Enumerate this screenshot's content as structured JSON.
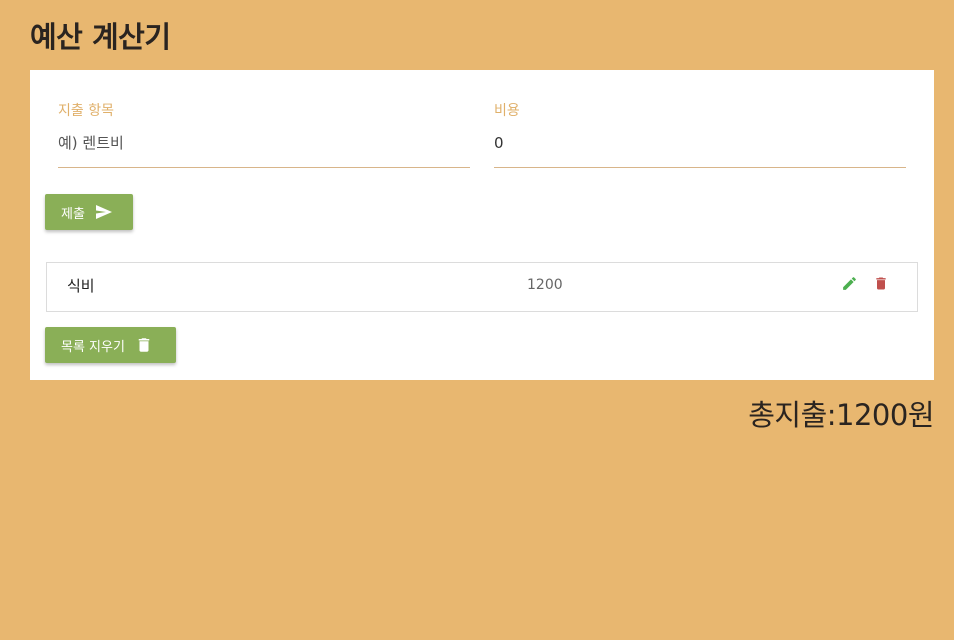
{
  "app": {
    "title": "예산 계산기"
  },
  "form": {
    "name_label": "지출 항목",
    "name_placeholder": "예) 렌트비",
    "name_value": "",
    "cost_label": "비용",
    "cost_value": "0",
    "submit_label": "제출"
  },
  "expenses": [
    {
      "name": "식비",
      "amount": "1200"
    }
  ],
  "clear_button": {
    "label": "목록 지우기"
  },
  "total": {
    "text": "총지출:1200원"
  },
  "icons": {
    "submit": "send-icon",
    "edit": "pencil-icon",
    "delete": "trash-icon",
    "clear": "trash-icon"
  },
  "colors": {
    "background": "#e8b770",
    "accent_label": "#e0b06a",
    "button": "#8aaf57",
    "edit_icon": "#4caf50",
    "delete_icon": "#c0504d"
  }
}
